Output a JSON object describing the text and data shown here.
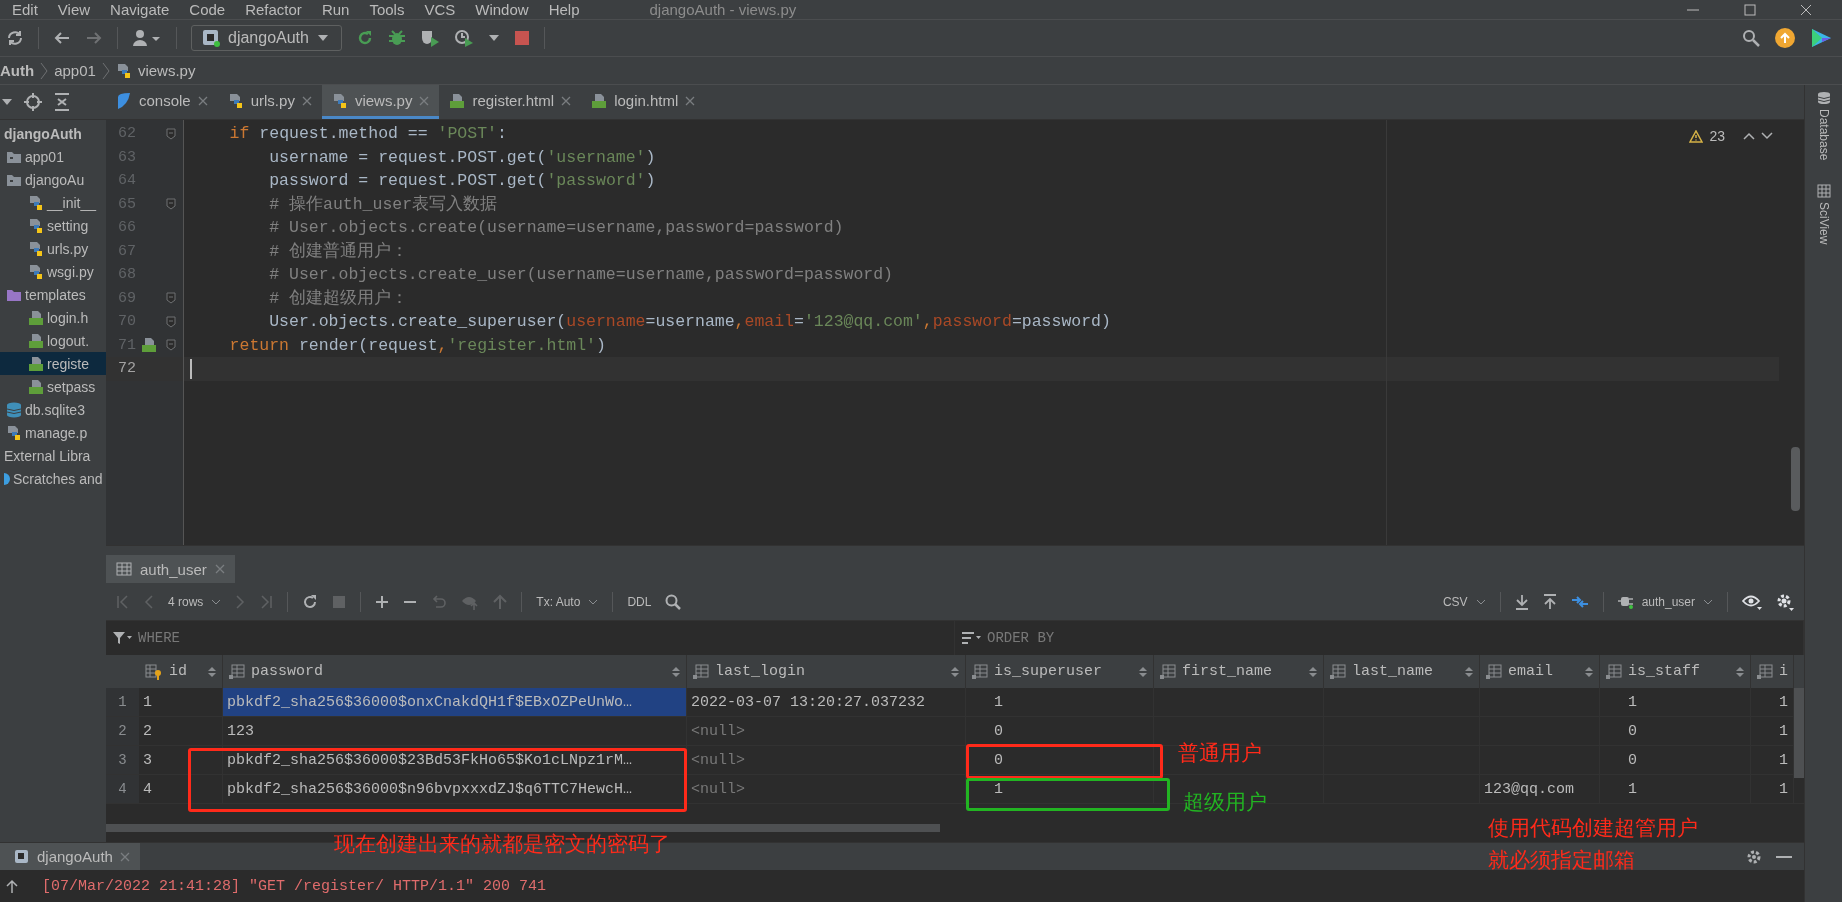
{
  "menu_bar": {
    "items": [
      "Edit",
      "View",
      "Navigate",
      "Code",
      "Refactor",
      "Run",
      "Tools",
      "VCS",
      "Window",
      "Help"
    ],
    "title": "djangoAuth - views.py"
  },
  "toolbar": {
    "run_config": "djangoAuth"
  },
  "breadcrumb": [
    "Auth",
    "app01",
    "views.py"
  ],
  "project_tree": [
    {
      "label": "djangoAuth",
      "kind": "project",
      "selected": false,
      "children": [
        {
          "label": "app01",
          "kind": "folder",
          "selected": false
        },
        {
          "label": "djangoAu",
          "kind": "folder",
          "selected": false,
          "children": [
            {
              "label": "__init__",
              "kind": "python",
              "selected": false
            },
            {
              "label": "setting",
              "kind": "python",
              "selected": false
            },
            {
              "label": "urls.py",
              "kind": "python",
              "selected": false
            },
            {
              "label": "wsgi.py",
              "kind": "python",
              "selected": false
            }
          ]
        },
        {
          "label": "templates",
          "kind": "templates",
          "selected": false,
          "children": [
            {
              "label": "login.h",
              "kind": "html",
              "selected": false
            },
            {
              "label": "logout.",
              "kind": "html",
              "selected": false
            },
            {
              "label": "registe",
              "kind": "html",
              "selected": true
            },
            {
              "label": "setpass",
              "kind": "html",
              "selected": false
            }
          ]
        },
        {
          "label": "db.sqlite3",
          "kind": "db",
          "selected": false
        },
        {
          "label": "manage.p",
          "kind": "python",
          "selected": false
        }
      ]
    },
    {
      "label": "External Libra",
      "kind": "library",
      "selected": false
    },
    {
      "label": "Scratches and",
      "kind": "scratches",
      "selected": false
    }
  ],
  "editor_tabs": [
    {
      "label": "console",
      "kind": "console",
      "selected": false
    },
    {
      "label": "urls.py",
      "kind": "python",
      "selected": false
    },
    {
      "label": "views.py",
      "kind": "python",
      "selected": true
    },
    {
      "label": "register.html",
      "kind": "html",
      "selected": false
    },
    {
      "label": "login.html",
      "kind": "html",
      "selected": false
    }
  ],
  "editor": {
    "warning_count": "23",
    "lines": [
      {
        "number": "62",
        "kind": "code",
        "fold": true,
        "current": false,
        "tokens": [
          {
            "t": "    if",
            "kind": "kw"
          },
          {
            "t": " request.method == ",
            "kind": "plain"
          },
          {
            "t": "'POST'",
            "kind": "str"
          },
          {
            "t": ":",
            "kind": "plain"
          }
        ]
      },
      {
        "number": "63",
        "kind": "code",
        "fold": false,
        "current": false,
        "tokens": [
          {
            "t": "        username = request.POST.get(",
            "kind": "plain"
          },
          {
            "t": "'username'",
            "kind": "str"
          },
          {
            "t": ")",
            "kind": "plain"
          }
        ]
      },
      {
        "number": "64",
        "kind": "code",
        "fold": false,
        "current": false,
        "tokens": [
          {
            "t": "        password = request.POST.get(",
            "kind": "plain"
          },
          {
            "t": "'password'",
            "kind": "str"
          },
          {
            "t": ")",
            "kind": "plain"
          }
        ]
      },
      {
        "number": "65",
        "kind": "code",
        "fold": true,
        "current": false,
        "tokens": [
          {
            "t": "        # 操作auth_user表写入数据",
            "kind": "cmt"
          }
        ]
      },
      {
        "number": "66",
        "kind": "code",
        "fold": false,
        "current": false,
        "tokens": [
          {
            "t": "        # User.objects.create(username=username,password=password)",
            "kind": "cmt"
          }
        ]
      },
      {
        "number": "67",
        "kind": "code",
        "fold": false,
        "current": false,
        "tokens": [
          {
            "t": "        # 创建普通用户：",
            "kind": "cmt"
          }
        ]
      },
      {
        "number": "68",
        "kind": "code",
        "fold": false,
        "current": false,
        "tokens": [
          {
            "t": "        # User.objects.create_user(username=username,password=password)",
            "kind": "cmt"
          }
        ]
      },
      {
        "number": "69",
        "kind": "code",
        "fold": true,
        "current": false,
        "tokens": [
          {
            "t": "        # 创建超级用户：",
            "kind": "cmt"
          }
        ]
      },
      {
        "number": "70",
        "kind": "code",
        "fold": true,
        "current": false,
        "tokens": [
          {
            "t": "        User.objects.create_superuser(",
            "kind": "plain"
          },
          {
            "t": "username",
            "kind": "param"
          },
          {
            "t": "=username",
            "kind": "plain"
          },
          {
            "t": ",",
            "kind": "punct"
          },
          {
            "t": "email",
            "kind": "param"
          },
          {
            "t": "=",
            "kind": "plain"
          },
          {
            "t": "'123@qq.com'",
            "kind": "str"
          },
          {
            "t": ",",
            "kind": "punct"
          },
          {
            "t": "password",
            "kind": "param"
          },
          {
            "t": "=password)",
            "kind": "plain"
          }
        ]
      },
      {
        "number": "71",
        "kind": "template_link",
        "fold": true,
        "current": false,
        "tokens": [
          {
            "t": "    return",
            "kind": "kw"
          },
          {
            "t": " render(request",
            "kind": "plain"
          },
          {
            "t": ",",
            "kind": "punct"
          },
          {
            "t": "'register.html'",
            "kind": "str"
          },
          {
            "t": ")",
            "kind": "plain"
          }
        ]
      },
      {
        "number": "72",
        "kind": "code",
        "fold": false,
        "current": true
      }
    ]
  },
  "db_panel": {
    "tab": "auth_user",
    "rows_label": "4 rows",
    "tx": "Tx: Auto",
    "ddl": "DDL",
    "export": "CSV",
    "data_source": "auth_user",
    "where": "WHERE",
    "order_by": "ORDER BY",
    "columns": [
      {
        "name": "id",
        "kind": "key"
      },
      {
        "name": "password",
        "kind": "text"
      },
      {
        "name": "last_login",
        "kind": "text"
      },
      {
        "name": "is_superuser",
        "kind": "bool"
      },
      {
        "name": "first_name",
        "kind": "text"
      },
      {
        "name": "last_name",
        "kind": "text"
      },
      {
        "name": "email",
        "kind": "text"
      },
      {
        "name": "is_staff",
        "kind": "bool"
      },
      {
        "name": "i",
        "kind": "bool"
      }
    ],
    "rows": [
      {
        "number": "1",
        "selected": true,
        "cells": [
          "1",
          "pbkdf2_sha256$36000$onxCnakdQH1f$EBxOZPeUnWo…",
          "2022-03-07 13:20:27.037232",
          "1",
          null,
          null,
          null,
          "1",
          "1"
        ]
      },
      {
        "number": "2",
        "selected": false,
        "cells": [
          "2",
          "123",
          "<null>",
          "0",
          null,
          null,
          null,
          "0",
          "1"
        ]
      },
      {
        "number": "3",
        "selected": false,
        "cells": [
          "3",
          "pbkdf2_sha256$36000$23Bd53FkHo65$Ko1cLNpz1rM…",
          "<null>",
          "0",
          null,
          null,
          null,
          "0",
          "1"
        ]
      },
      {
        "number": "4",
        "selected": false,
        "cells": [
          "4",
          "pbkdf2_sha256$36000$n96bvpxxxdZJ$q6TTC7HewcH…",
          "<null>",
          "1",
          null,
          null,
          "123@qq.com",
          "1",
          "1"
        ]
      }
    ]
  },
  "run_panel": {
    "tab": "djangoAuth",
    "log": "[07/Mar/2022 21:41:28] \"GET /register/ HTTP/1.1\" 200 741"
  },
  "side_strip": [
    {
      "label": "Database",
      "kind": "db"
    },
    {
      "label": "SciView",
      "kind": "grid"
    }
  ],
  "annotations": {
    "boxes": [
      {
        "color": "#ff2a1a"
      },
      {
        "color": "#ff2a1a"
      },
      {
        "color": "#22b422"
      }
    ],
    "notes": [
      {
        "lines": [
          "普通用户"
        ],
        "color": "#ff2a1a"
      },
      {
        "lines": [
          "超级用户"
        ],
        "color": "#22b422"
      },
      {
        "lines": [
          "现在创建出来的就都是密文的密码了"
        ],
        "color": "#ff2a1a"
      },
      {
        "lines": [
          "使用代码创建超管用户",
          "就必须指定邮箱"
        ],
        "color": "#ff2a1a"
      }
    ]
  }
}
